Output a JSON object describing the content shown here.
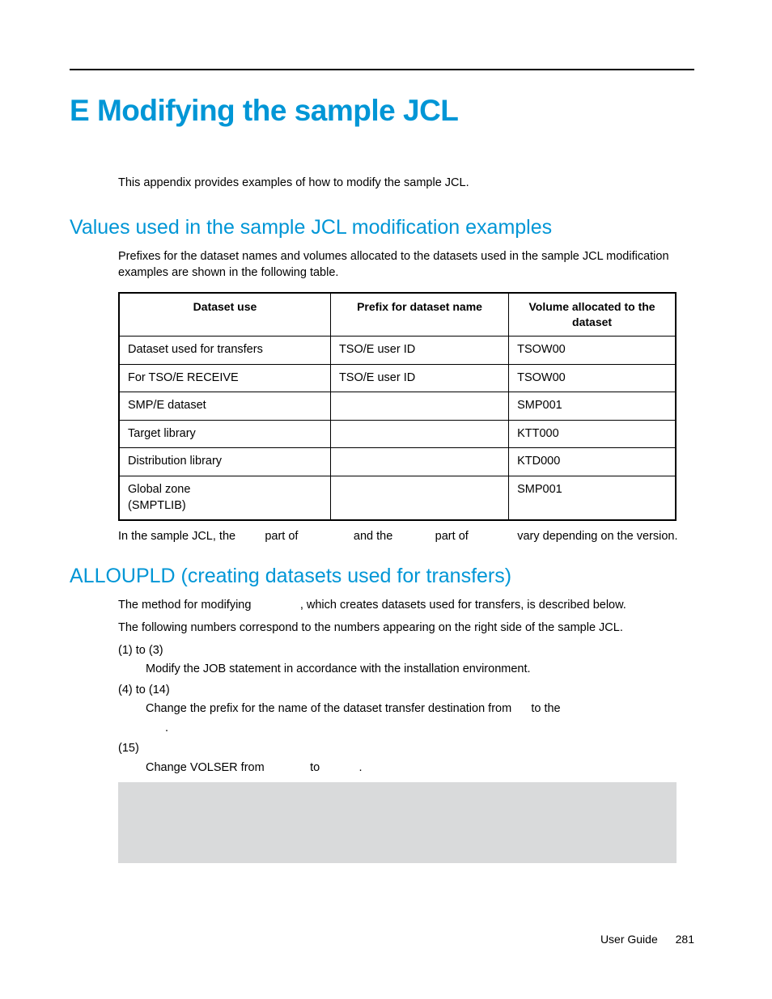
{
  "h1": "E Modifying the sample JCL",
  "intro": "This appendix provides examples of how to modify the sample JCL.",
  "h2a": "Values used in the sample JCL modification examples",
  "para_a": "Prefixes for the dataset names and volumes allocated to the datasets used in the sample JCL modification examples are shown in the following table.",
  "table": {
    "headers": [
      "Dataset use",
      "Prefix for dataset name",
      "Volume allocated to the dataset"
    ],
    "rows": [
      [
        "Dataset used for transfers",
        "TSO/E user ID",
        "TSOW00"
      ],
      [
        "For TSO/E RECEIVE",
        "TSO/E user ID",
        "TSOW00"
      ],
      [
        "SMP/E dataset",
        "",
        "SMP001"
      ],
      [
        "Target library",
        "",
        "KTT000"
      ],
      [
        "Distribution library",
        "",
        "KTD000"
      ],
      [
        "Global zone\n(SMPTLIB)",
        "",
        "SMP001"
      ]
    ]
  },
  "note_after_table": "In the sample JCL, the         part of                 and the             part of               vary depending on the version.",
  "h2b": "ALLOUPLD (creating datasets used for transfers)",
  "para_b1": "The method for modifying               , which creates datasets used for transfers, is described below.",
  "para_b2": "The following numbers correspond to the numbers appearing on the right side of the sample JCL.",
  "list": [
    {
      "num": "(1) to (3)",
      "desc": "Modify the JOB statement in accordance with the installation environment."
    },
    {
      "num": "(4) to (14)",
      "desc": "Change the prefix for the name of the dataset transfer destination from      to the",
      "desc2": "."
    },
    {
      "num": "(15)",
      "desc": "Change VOLSER from              to            ."
    }
  ],
  "footer_label": "User Guide",
  "footer_page": "281"
}
